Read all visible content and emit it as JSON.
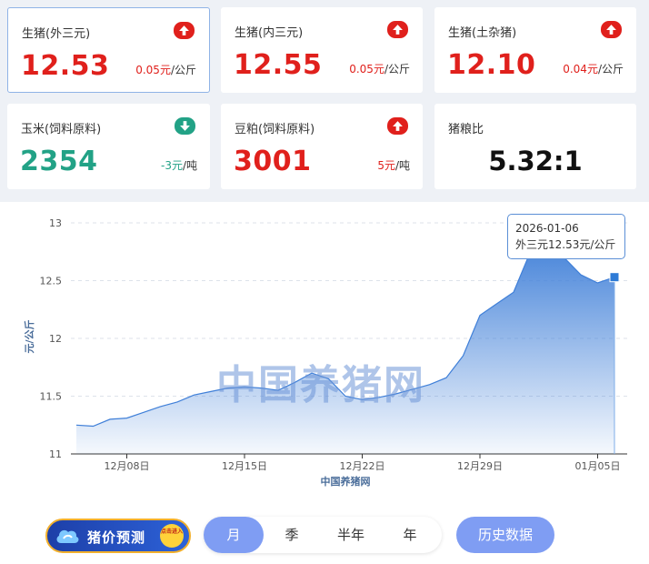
{
  "cards": [
    {
      "name": "生猪(外三元)",
      "price": "12.53",
      "change_num": "0.05元",
      "change_unit": "/公斤",
      "trend": "up"
    },
    {
      "name": "生猪(内三元)",
      "price": "12.55",
      "change_num": "0.05元",
      "change_unit": "/公斤",
      "trend": "up"
    },
    {
      "name": "生猪(土杂猪)",
      "price": "12.10",
      "change_num": "0.04元",
      "change_unit": "/公斤",
      "trend": "up"
    },
    {
      "name": "玉米(饲料原料)",
      "price": "2354",
      "change_num": "-3元",
      "change_unit": "/吨",
      "trend": "down"
    },
    {
      "name": "豆粕(饲料原料)",
      "price": "3001",
      "change_num": "5元",
      "change_unit": "/吨",
      "trend": "up"
    },
    {
      "name": "猪粮比",
      "price": "5.32:1"
    }
  ],
  "chart_data": {
    "type": "area",
    "ylabel": "元/公斤",
    "xlabel": "中国养猪网",
    "ylim": [
      11,
      13
    ],
    "yticks": [
      "13",
      "12.5",
      "12",
      "11.5",
      "11"
    ],
    "xtick_labels": [
      "12月08日",
      "12月15日",
      "12月22日",
      "12月29日",
      "01月05日"
    ],
    "series": [
      {
        "name": "外三元",
        "x": [
          "12-05",
          "12-06",
          "12-07",
          "12-08",
          "12-09",
          "12-10",
          "12-11",
          "12-12",
          "12-13",
          "12-14",
          "12-15",
          "12-16",
          "12-17",
          "12-18",
          "12-19",
          "12-20",
          "12-21",
          "12-22",
          "12-23",
          "12-24",
          "12-25",
          "12-26",
          "12-27",
          "12-28",
          "12-29",
          "12-30",
          "12-31",
          "01-01",
          "01-02",
          "01-03",
          "01-04",
          "01-05",
          "01-06"
        ],
        "values": [
          11.25,
          11.24,
          11.3,
          11.31,
          11.36,
          11.41,
          11.45,
          11.51,
          11.54,
          11.57,
          11.58,
          11.57,
          11.55,
          11.62,
          11.7,
          11.65,
          11.5,
          11.47,
          11.49,
          11.52,
          11.56,
          11.6,
          11.66,
          11.85,
          12.2,
          12.3,
          12.4,
          12.75,
          12.8,
          12.7,
          12.55,
          12.48,
          12.53
        ]
      }
    ]
  },
  "watermark": "中国养猪网",
  "tooltip": {
    "date": "2026-01-06",
    "text": "外三元12.53元/公斤"
  },
  "bottom": {
    "predict_label": "猪价预测",
    "predict_badge": "点击进入",
    "tabs": [
      "月",
      "季",
      "半年",
      "年"
    ],
    "active_tab": "月",
    "history_label": "历史数据"
  },
  "colors": {
    "up": "#e0201c",
    "down": "#22a286",
    "accent": "#7f9df3",
    "line": "#3f7fd8"
  }
}
